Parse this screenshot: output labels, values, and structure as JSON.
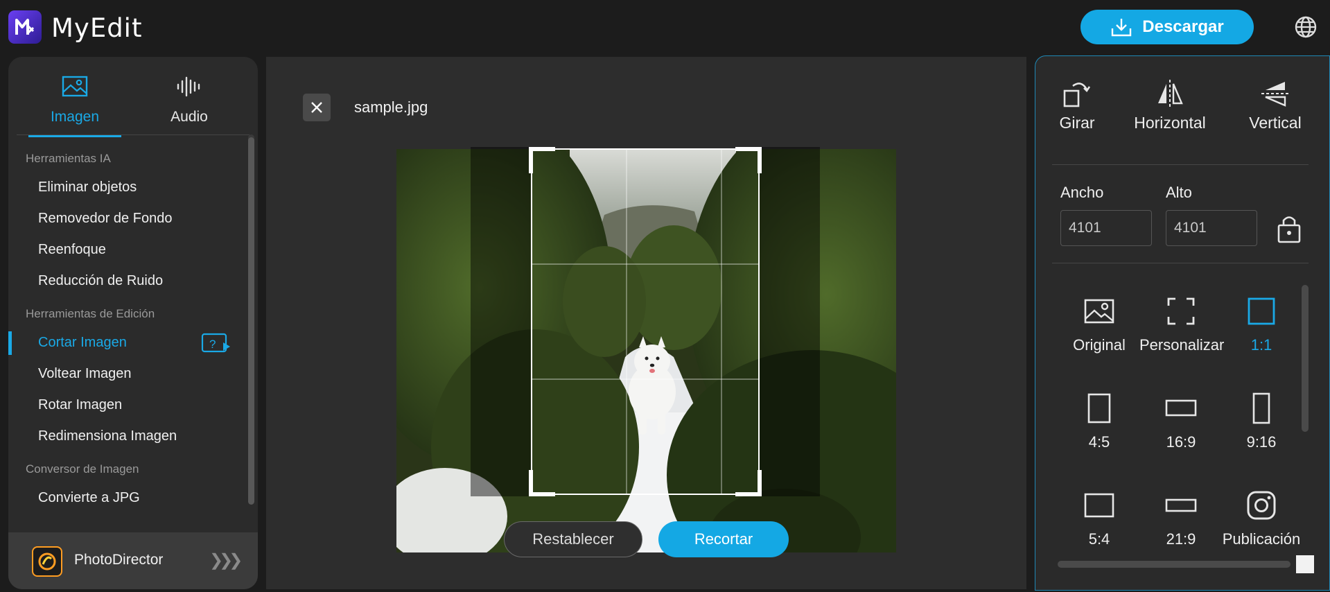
{
  "app": {
    "name": "MyEdit",
    "download_label": "Descargar"
  },
  "tabs": [
    {
      "label": "Imagen",
      "icon": "image-icon",
      "active": true
    },
    {
      "label": "Audio",
      "icon": "audio-waveform-icon",
      "active": false
    }
  ],
  "sidebar": {
    "sections": [
      {
        "title": "Herramientas IA",
        "items": [
          "Eliminar objetos",
          "Removedor de Fondo",
          "Reenfoque",
          "Reducción de Ruido"
        ]
      },
      {
        "title": "Herramientas de Edición",
        "items": [
          "Cortar Imagen",
          "Voltear Imagen",
          "Rotar Imagen",
          "Redimensiona Imagen"
        ]
      },
      {
        "title": "Conversor de Imagen",
        "items": [
          "Convierte a JPG"
        ]
      }
    ],
    "active_item": "Cortar Imagen",
    "promo_label": "PhotoDirector"
  },
  "workspace": {
    "file_name": "sample.jpg",
    "reset_label": "Restablecer",
    "crop_label": "Recortar"
  },
  "panel": {
    "tools": [
      {
        "label": "Girar",
        "icon": "rotate-icon"
      },
      {
        "label": "Horizontal",
        "icon": "flip-horizontal-icon"
      },
      {
        "label": "Vertical",
        "icon": "flip-vertical-icon"
      }
    ],
    "width_label": "Ancho",
    "height_label": "Alto",
    "width_value": "4101",
    "height_value": "4101",
    "ratios": [
      {
        "label": "Original",
        "icon": "image-icon"
      },
      {
        "label": "Personalizar",
        "icon": "custom-frame-icon"
      },
      {
        "label": "1:1",
        "icon": "square-icon",
        "active": true
      },
      {
        "label": "4:5",
        "icon": "portrait-icon"
      },
      {
        "label": "16:9",
        "icon": "landscape-icon"
      },
      {
        "label": "9:16",
        "icon": "tall-portrait-icon"
      },
      {
        "label": "5:4",
        "icon": "landscape-icon"
      },
      {
        "label": "21:9",
        "icon": "wide-landscape-icon"
      },
      {
        "label": "Publicación",
        "icon": "instagram-icon"
      }
    ]
  },
  "colors": {
    "accent": "#14a8e4",
    "panel": "#2a2a2a",
    "background": "#1c1c1c"
  }
}
